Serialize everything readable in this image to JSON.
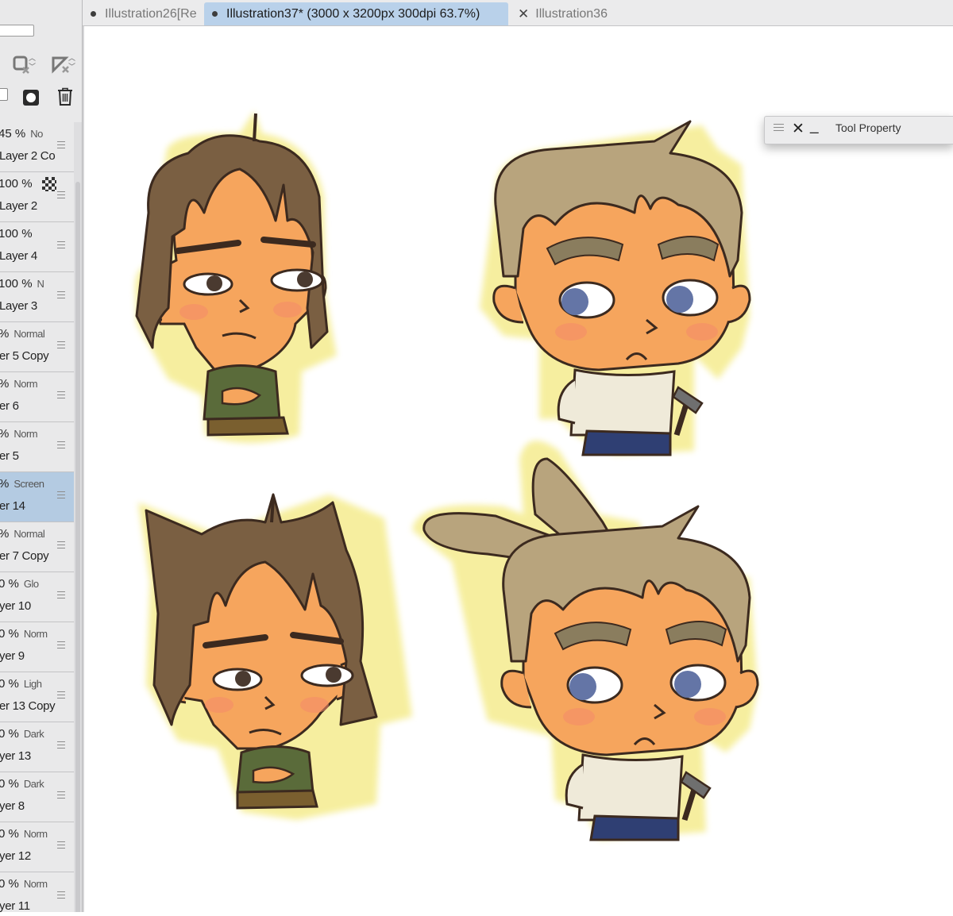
{
  "tabs": [
    {
      "label": "Illustration26[Re",
      "marker": "dot"
    },
    {
      "label": "Illustration37* (3000 x 3200px 300dpi 63.7%)",
      "marker": "dot"
    },
    {
      "label": "Illustration36",
      "marker": "close"
    }
  ],
  "tool_property": {
    "title": "Tool Property"
  },
  "layer_panel": {
    "layers": [
      {
        "opacity": "45 %",
        "mode": "No",
        "name": "Layer 2 Co"
      },
      {
        "opacity": "100 %",
        "mode": "",
        "name": "Layer 2"
      },
      {
        "opacity": "100 %",
        "mode": "",
        "name": "Layer 4"
      },
      {
        "opacity": "100 %",
        "mode": "N",
        "name": "Layer 3"
      },
      {
        "opacity": "%",
        "mode": "Normal",
        "name": "er 5 Copy"
      },
      {
        "opacity": "%",
        "mode": "Norm",
        "name": "er 6"
      },
      {
        "opacity": "%",
        "mode": "Norm",
        "name": "er 5"
      },
      {
        "opacity": "%",
        "mode": "Screen",
        "name": "er 14",
        "selected": true
      },
      {
        "opacity": "%",
        "mode": "Normal",
        "name": "er 7 Copy"
      },
      {
        "opacity": "0 %",
        "mode": "Glo",
        "name": "yer 10"
      },
      {
        "opacity": "0 %",
        "mode": "Norm",
        "name": "yer 9"
      },
      {
        "opacity": "0 %",
        "mode": "Ligh",
        "name": "er 13 Copy"
      },
      {
        "opacity": "0 %",
        "mode": "Dark",
        "name": "yer 13"
      },
      {
        "opacity": "0 %",
        "mode": "Dark",
        "name": "yer 8"
      },
      {
        "opacity": "0 %",
        "mode": "Norm",
        "name": "yer 12"
      },
      {
        "opacity": "0 %",
        "mode": "Norm",
        "name": "yer 11"
      }
    ]
  },
  "colors": {
    "tab_active": "#b9d1ea",
    "selected_layer": "#b4cbe2",
    "sticker_glow": "#f6ee9a",
    "skin": "#f6a55d",
    "dark_hair": "#7a5f42",
    "light_hair": "#b8a47d"
  }
}
